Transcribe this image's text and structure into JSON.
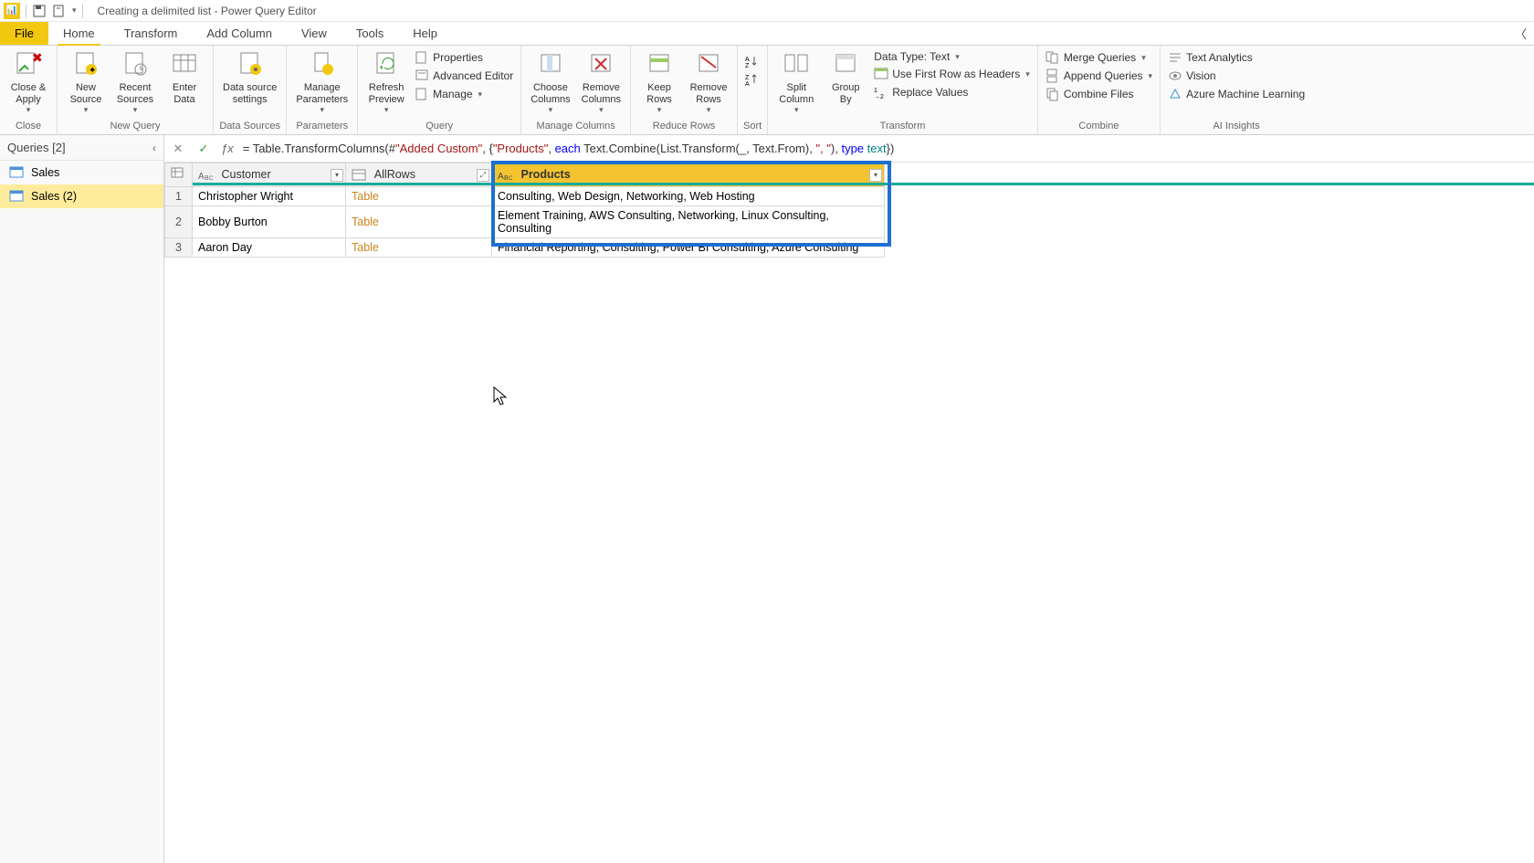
{
  "title": "Creating a delimited list - Power Query Editor",
  "tabs": {
    "file": "File",
    "home": "Home",
    "transform": "Transform",
    "addcolumn": "Add Column",
    "view": "View",
    "tools": "Tools",
    "help": "Help"
  },
  "ribbon": {
    "close": {
      "close_apply": "Close &\nApply",
      "group": "Close"
    },
    "newquery": {
      "new_source": "New\nSource",
      "recent_sources": "Recent\nSources",
      "enter_data": "Enter\nData",
      "group": "New Query"
    },
    "datasources": {
      "data_source_settings": "Data source\nsettings",
      "group": "Data Sources"
    },
    "parameters": {
      "manage_parameters": "Manage\nParameters",
      "group": "Parameters"
    },
    "query": {
      "refresh_preview": "Refresh\nPreview",
      "properties": "Properties",
      "advanced_editor": "Advanced Editor",
      "manage": "Manage",
      "group": "Query"
    },
    "managecols": {
      "choose_columns": "Choose\nColumns",
      "remove_columns": "Remove\nColumns",
      "group": "Manage Columns"
    },
    "reducerows": {
      "keep_rows": "Keep\nRows",
      "remove_rows": "Remove\nRows",
      "group": "Reduce Rows"
    },
    "sort": {
      "group": "Sort"
    },
    "transform": {
      "split_column": "Split\nColumn",
      "group_by": "Group\nBy",
      "data_type": "Data Type: Text",
      "first_row_headers": "Use First Row as Headers",
      "replace_values": "Replace Values",
      "group": "Transform"
    },
    "combine": {
      "merge_queries": "Merge Queries",
      "append_queries": "Append Queries",
      "combine_files": "Combine Files",
      "group": "Combine"
    },
    "ai": {
      "text_analytics": "Text Analytics",
      "vision": "Vision",
      "azure_ml": "Azure Machine Learning",
      "group": "AI Insights"
    }
  },
  "sidebar": {
    "header": "Queries [2]",
    "items": [
      "Sales",
      "Sales (2)"
    ]
  },
  "formula": {
    "pre": "= Table.TransformColumns(#",
    "s1": "\"Added Custom\"",
    "mid1": ", {",
    "s2": "\"Products\"",
    "mid2": ", ",
    "kw1": "each",
    "mid3": " Text.Combine(List.Transform(_, Text.From), ",
    "s3": "\", \"",
    "mid4": "), ",
    "kw2": "type",
    "sp": " ",
    "ty": "text",
    "end": "})"
  },
  "columns": {
    "c1": "Customer",
    "c2": "AllRows",
    "c3": "Products"
  },
  "rows": [
    {
      "n": "1",
      "customer": "Christopher Wright",
      "allrows": "Table",
      "products": "Consulting, Web Design, Networking, Web Hosting"
    },
    {
      "n": "2",
      "customer": "Bobby Burton",
      "allrows": "Table",
      "products": "Element Training, AWS Consulting, Networking, Linux Consulting, Consulting"
    },
    {
      "n": "3",
      "customer": "Aaron Day",
      "allrows": "Table",
      "products": "Financial Reporting, Consulting, Power BI Consulting, Azure Consulting"
    }
  ]
}
